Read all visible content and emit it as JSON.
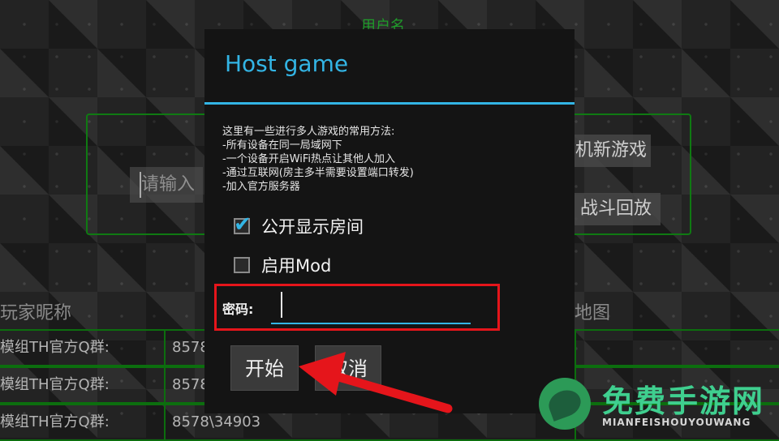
{
  "background": {
    "username_label": "用户名",
    "name_input_text": "请输入",
    "buttons": {
      "new_game": "机新游戏",
      "replay": "战斗回放"
    },
    "table": {
      "headers": {
        "nickname": "玩家昵称",
        "map": "地图"
      },
      "rows": [
        {
          "player": "模组TH官方Q群:",
          "value": "8578"
        },
        {
          "player": "模组TH官方Q群:",
          "value": "8578"
        },
        {
          "player": "模组TH官方Q群:",
          "value": "8578\\34903"
        }
      ]
    }
  },
  "dialog": {
    "title": "Host game",
    "description": [
      "这里有一些进行多人游戏的常用方法:",
      "-所有设备在同一局域网下",
      "-一个设备开启WiFi热点让其他人加入",
      "-通过互联网(房主多半需要设置端口转发)",
      "-加入官方服务器"
    ],
    "public_room": {
      "label": "公开显示房间",
      "checked": true
    },
    "enable_mod": {
      "label": "启用Mod",
      "checked": false
    },
    "password": {
      "label": "密码:",
      "value": ""
    },
    "buttons": {
      "start": "开始",
      "cancel": "取消"
    }
  },
  "watermark": {
    "title": "免费手游网",
    "subtitle": "MIANFEISHOUYOUWANG"
  },
  "colors": {
    "accent": "#33b5e5",
    "green": "#0c6e0e",
    "highlight": "#e5151b"
  }
}
